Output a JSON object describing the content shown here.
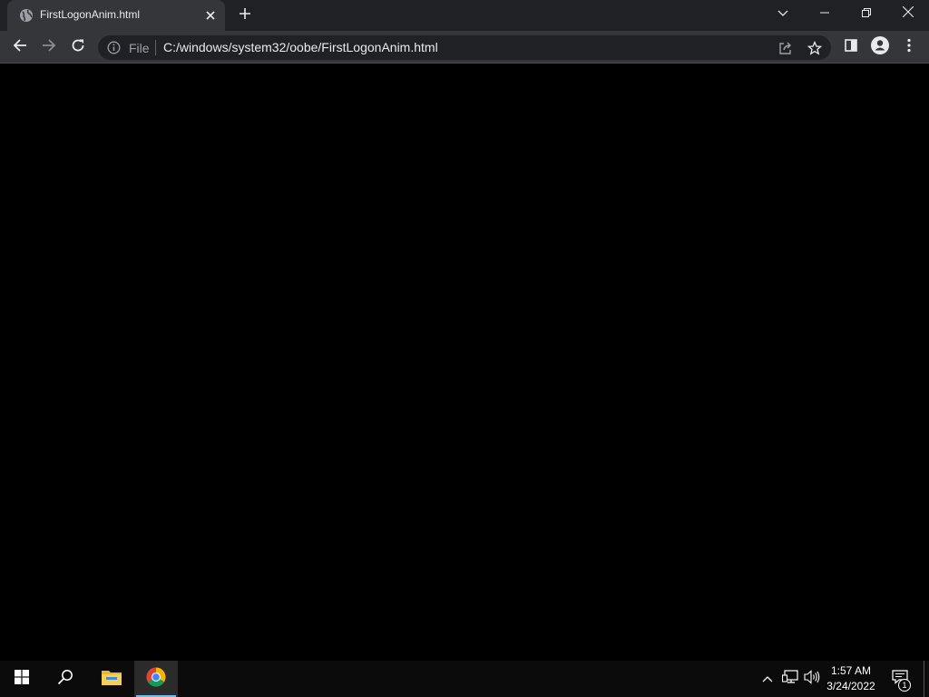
{
  "browser": {
    "tab": {
      "title": "FirstLogonAnim.html",
      "favicon": "globe-icon"
    },
    "new_tab_icon": "plus-icon",
    "window_controls": [
      "chevron-down-icon",
      "minimize-icon",
      "restore-icon",
      "close-icon"
    ],
    "nav": {
      "back_icon": "arrow-left-icon",
      "forward_icon": "arrow-right-icon",
      "reload_icon": "reload-icon"
    },
    "omnibox": {
      "security_icon": "info-icon",
      "scheme_label": "File",
      "url": "C:/windows/system32/oobe/FirstLogonAnim.html",
      "actions": [
        "share-icon",
        "star-icon"
      ]
    },
    "toolbar_icons": [
      "side-panel-icon",
      "profile-icon",
      "menu-kebab-icon"
    ]
  },
  "page": {
    "background": "#000000"
  },
  "taskbar": {
    "start_icon": "windows-start-icon",
    "search_icon": "search-icon",
    "pinned": [
      {
        "name": "file-explorer-icon",
        "active": false
      },
      {
        "name": "chrome-icon",
        "active": true
      }
    ],
    "tray": [
      "chevron-up-icon",
      "network-icon",
      "volume-icon"
    ],
    "clock": {
      "time": "1:57 AM",
      "date": "3/24/2022"
    },
    "notifications": {
      "icon": "action-center-icon",
      "count": "1"
    }
  },
  "colors": {
    "tabstrip": "#202124",
    "toolbar": "#35363a",
    "omnibox": "#202124",
    "text": "#e8eaed",
    "muted": "#9aa0a6",
    "taskbar": "#0b0b0b",
    "accent": "#76b9ed"
  }
}
